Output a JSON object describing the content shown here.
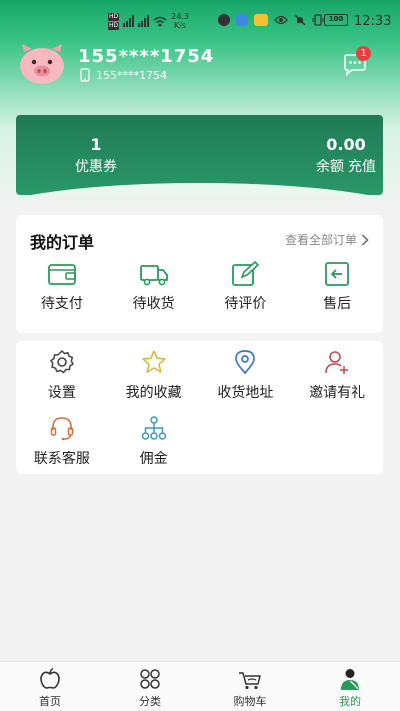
{
  "status_bar": {
    "network_speed_value": "24.3",
    "network_speed_unit": "K/s",
    "battery": "100",
    "time": "12:33"
  },
  "profile": {
    "username": "155****1754",
    "phone": "155****1754",
    "message_badge": "1"
  },
  "wallet": {
    "coupon_count": "1",
    "coupon_label": "优惠券",
    "balance": "0.00",
    "balance_label": "余额",
    "recharge_label": "充值"
  },
  "orders": {
    "title": "我的订单",
    "view_all": "查看全部订单",
    "items": [
      {
        "label": "待支付",
        "icon": "wallet-icon"
      },
      {
        "label": "待收货",
        "icon": "truck-icon"
      },
      {
        "label": "待评价",
        "icon": "edit-icon"
      },
      {
        "label": "售后",
        "icon": "return-icon"
      }
    ]
  },
  "services": {
    "items": [
      {
        "label": "设置",
        "icon": "gear-icon"
      },
      {
        "label": "我的收藏",
        "icon": "star-icon"
      },
      {
        "label": "收货地址",
        "icon": "location-pin-icon"
      },
      {
        "label": "邀请有礼",
        "icon": "add-user-icon"
      },
      {
        "label": "联系客服",
        "icon": "headset-icon"
      },
      {
        "label": "佣金",
        "icon": "network-icon"
      }
    ]
  },
  "tabbar": {
    "items": [
      {
        "label": "首页",
        "icon": "apple-icon"
      },
      {
        "label": "分类",
        "icon": "grid-icon"
      },
      {
        "label": "购物车",
        "icon": "cart-icon"
      },
      {
        "label": "我的",
        "icon": "user-icon"
      }
    ],
    "active_index": 3
  },
  "colors": {
    "brand_green": "#2a9a5b",
    "header_green": "#16a768",
    "badge_red": "#e8413b"
  }
}
